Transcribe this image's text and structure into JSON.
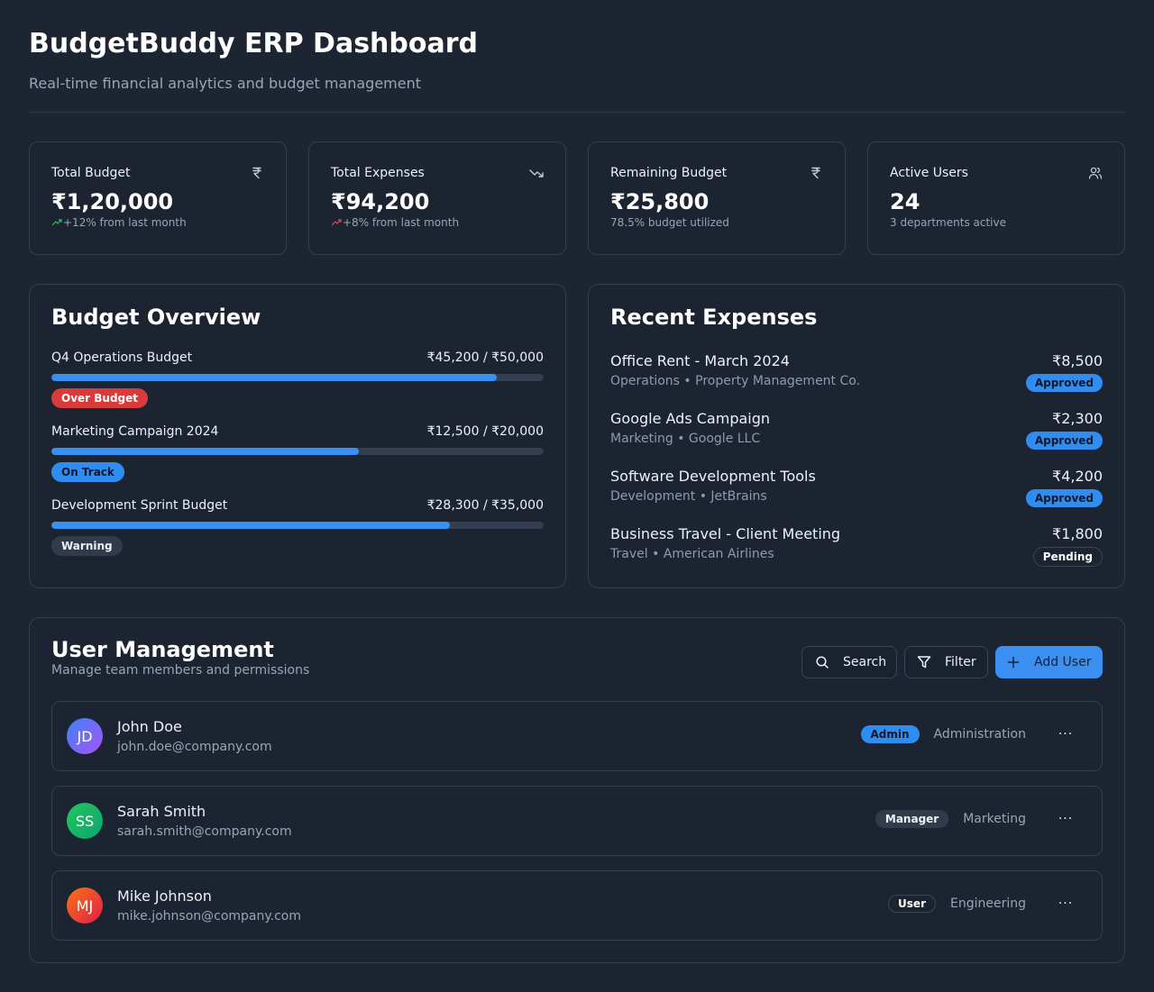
{
  "header": {
    "title": "BudgetBuddy ERP Dashboard",
    "subtitle": "Real-time financial analytics and budget management"
  },
  "stats": [
    {
      "label": "Total Budget",
      "value": "₹1,20,000",
      "sub": "+12% from last month",
      "icon": "rupee-icon",
      "trend": "up",
      "trend_color": "#22c55e"
    },
    {
      "label": "Total Expenses",
      "value": "₹94,200",
      "sub": "+8% from last month",
      "icon": "trending-down-icon",
      "trend": "up",
      "trend_color": "#ef4444"
    },
    {
      "label": "Remaining Budget",
      "value": "₹25,800",
      "sub": "78.5% budget utilized",
      "icon": "rupee-icon"
    },
    {
      "label": "Active Users",
      "value": "24",
      "sub": "3 departments active",
      "icon": "users-icon"
    }
  ],
  "budget_overview": {
    "title": "Budget Overview",
    "items": [
      {
        "name": "Q4 Operations Budget",
        "amount": "₹45,200 / ₹50,000",
        "progress": 0.904,
        "status": "Over Budget"
      },
      {
        "name": "Marketing Campaign 2024",
        "amount": "₹12,500 / ₹20,000",
        "progress": 0.625,
        "status": "On Track"
      },
      {
        "name": "Development Sprint Budget",
        "amount": "₹28,300 / ₹35,000",
        "progress": 0.809,
        "status": "Warning"
      }
    ]
  },
  "recent_expenses": {
    "title": "Recent Expenses",
    "items": [
      {
        "name": "Office Rent - March 2024",
        "meta": "Operations • Property Management Co.",
        "amount": "₹8,500",
        "status": "Approved"
      },
      {
        "name": "Google Ads Campaign",
        "meta": "Marketing • Google LLC",
        "amount": "₹2,300",
        "status": "Approved"
      },
      {
        "name": "Software Development Tools",
        "meta": "Development • JetBrains",
        "amount": "₹4,200",
        "status": "Approved"
      },
      {
        "name": "Business Travel - Client Meeting",
        "meta": "Travel • American Airlines",
        "amount": "₹1,800",
        "status": "Pending"
      }
    ]
  },
  "user_management": {
    "title": "User Management",
    "subtitle": "Manage team members and permissions",
    "search_label": "Search",
    "filter_label": "Filter",
    "add_label": "Add User",
    "more_label": "···",
    "users": [
      {
        "initials": "JD",
        "name": "John Doe",
        "email": "john.doe@company.com",
        "role": "Admin",
        "department": "Administration"
      },
      {
        "initials": "SS",
        "name": "Sarah Smith",
        "email": "sarah.smith@company.com",
        "role": "Manager",
        "department": "Marketing"
      },
      {
        "initials": "MJ",
        "name": "Mike Johnson",
        "email": "mike.johnson@company.com",
        "role": "User",
        "department": "Engineering"
      }
    ]
  },
  "colors": {
    "background": "#1d2533",
    "accent": "#3b8ff0",
    "danger": "#d93a3a",
    "success": "#22c55e"
  }
}
